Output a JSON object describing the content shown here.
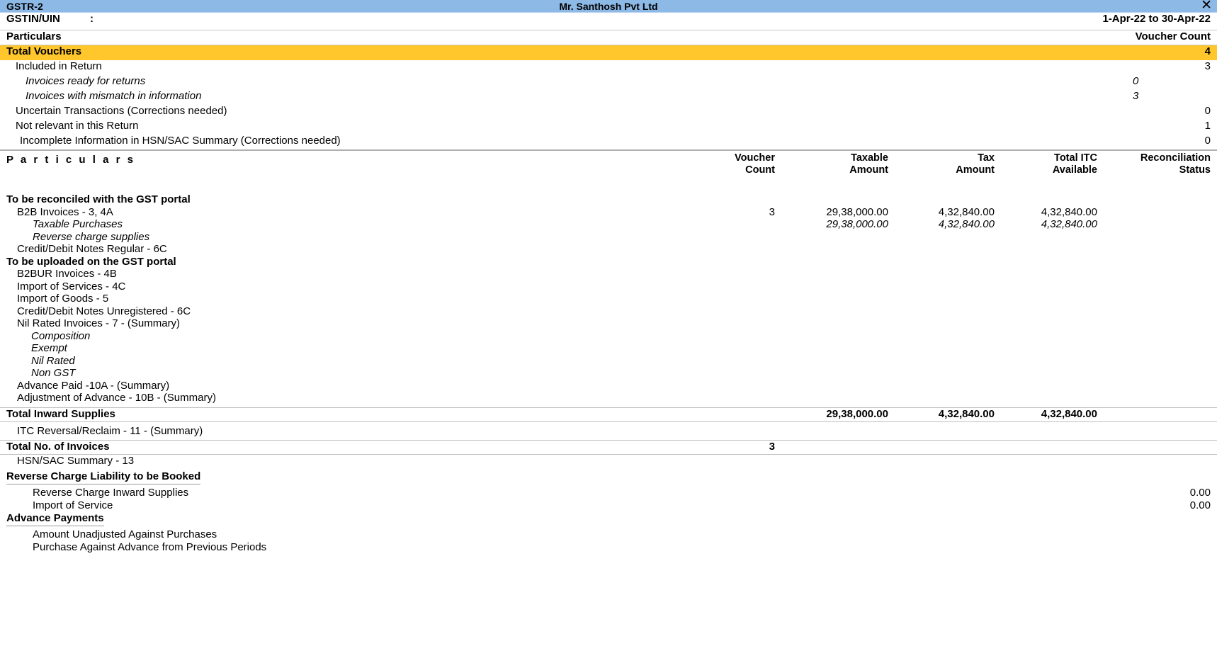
{
  "window": {
    "title": "GSTR-2",
    "company": "Mr. Santhosh Pvt Ltd",
    "close_icon": "close-icon",
    "close_glyph": "✕",
    "titlebar_color": "#8DB9E6"
  },
  "gstin": {
    "label": "GSTIN/UIN",
    "colon": ":",
    "value": "",
    "period": "1-Apr-22 to 30-Apr-22"
  },
  "summary_header": {
    "particulars": "Particulars",
    "voucher_count": "Voucher Count"
  },
  "summary": {
    "highlight_color": "#FFC72C",
    "total_vouchers": {
      "label": "Total Vouchers",
      "value": "4"
    },
    "rows": [
      {
        "label": "Included in Return",
        "mid": "",
        "value": "3",
        "indent": 1,
        "italic": false
      },
      {
        "label": "Invoices ready for returns",
        "mid": "0",
        "value": "",
        "indent": 2,
        "italic": true
      },
      {
        "label": "Invoices with mismatch in information",
        "mid": "3",
        "value": "",
        "indent": 2,
        "italic": true
      },
      {
        "label": "Uncertain Transactions (Corrections needed)",
        "mid": "",
        "value": "0",
        "indent": 1,
        "italic": false
      },
      {
        "label": "Not relevant in this Return",
        "mid": "",
        "value": "1",
        "indent": 1,
        "italic": false
      },
      {
        "label": "Incomplete Information in HSN/SAC Summary (Corrections needed)",
        "mid": "",
        "value": "0",
        "indent": 3,
        "italic": false
      }
    ]
  },
  "table_header": {
    "particulars": "P a r t i c u l a r s",
    "voucher_count_l1": "Voucher",
    "voucher_count_l2": "Count",
    "taxable_l1": "Taxable",
    "taxable_l2": "Amount",
    "tax_l1": "Tax",
    "tax_l2": "Amount",
    "itc_l1": "Total ITC",
    "itc_l2": "Available",
    "recon_l1": "Reconciliation",
    "recon_l2": "Status"
  },
  "table_rows": [
    {
      "label": "To be reconciled with the GST portal",
      "vc": "",
      "taxable": "",
      "tax": "",
      "itc": "",
      "recon": "",
      "indent": 0,
      "bold": true,
      "italic": false
    },
    {
      "label": "B2B Invoices - 3, 4A",
      "vc": "3",
      "taxable": "29,38,000.00",
      "tax": "4,32,840.00",
      "itc": "4,32,840.00",
      "recon": "",
      "indent": 1,
      "bold": false,
      "italic": false
    },
    {
      "label": "Taxable Purchases",
      "vc": "",
      "taxable": "29,38,000.00",
      "tax": "4,32,840.00",
      "itc": "4,32,840.00",
      "recon": "",
      "indent": 2,
      "bold": false,
      "italic": true
    },
    {
      "label": "Reverse charge supplies",
      "vc": "",
      "taxable": "",
      "tax": "",
      "itc": "",
      "recon": "",
      "indent": 2,
      "bold": false,
      "italic": true
    },
    {
      "label": "Credit/Debit Notes Regular - 6C",
      "vc": "",
      "taxable": "",
      "tax": "",
      "itc": "",
      "recon": "",
      "indent": 1,
      "bold": false,
      "italic": false
    },
    {
      "label": "To be uploaded on the GST portal",
      "vc": "",
      "taxable": "",
      "tax": "",
      "itc": "",
      "recon": "",
      "indent": 0,
      "bold": true,
      "italic": false
    },
    {
      "label": "B2BUR Invoices - 4B",
      "vc": "",
      "taxable": "",
      "tax": "",
      "itc": "",
      "recon": "",
      "indent": 1,
      "bold": false,
      "italic": false
    },
    {
      "label": "Import of Services - 4C",
      "vc": "",
      "taxable": "",
      "tax": "",
      "itc": "",
      "recon": "",
      "indent": 1,
      "bold": false,
      "italic": false
    },
    {
      "label": "Import of Goods - 5",
      "vc": "",
      "taxable": "",
      "tax": "",
      "itc": "",
      "recon": "",
      "indent": 1,
      "bold": false,
      "italic": false
    },
    {
      "label": "Credit/Debit Notes Unregistered - 6C",
      "vc": "",
      "taxable": "",
      "tax": "",
      "itc": "",
      "recon": "",
      "indent": 1,
      "bold": false,
      "italic": false
    },
    {
      "label": "Nil Rated Invoices - 7 - (Summary)",
      "vc": "",
      "taxable": "",
      "tax": "",
      "itc": "",
      "recon": "",
      "indent": 1,
      "bold": false,
      "italic": false
    },
    {
      "label": "Composition",
      "vc": "",
      "taxable": "",
      "tax": "",
      "itc": "",
      "recon": "",
      "indent": 2,
      "bold": false,
      "italic": true
    },
    {
      "label": "Exempt",
      "vc": "",
      "taxable": "",
      "tax": "",
      "itc": "",
      "recon": "",
      "indent": 2,
      "bold": false,
      "italic": true
    },
    {
      "label": "Nil Rated",
      "vc": "",
      "taxable": "",
      "tax": "",
      "itc": "",
      "recon": "",
      "indent": 2,
      "bold": false,
      "italic": true
    },
    {
      "label": "Non GST",
      "vc": "",
      "taxable": "",
      "tax": "",
      "itc": "",
      "recon": "",
      "indent": 2,
      "bold": false,
      "italic": true
    },
    {
      "label": "Advance Paid -10A - (Summary)",
      "vc": "",
      "taxable": "",
      "tax": "",
      "itc": "",
      "recon": "",
      "indent": 1,
      "bold": false,
      "italic": false
    },
    {
      "label": "Adjustment of Advance - 10B - (Summary)",
      "vc": "",
      "taxable": "",
      "tax": "",
      "itc": "",
      "recon": "",
      "indent": 1,
      "bold": false,
      "italic": false
    }
  ],
  "total_inward": {
    "label": "Total Inward Supplies",
    "vc": "",
    "taxable": "29,38,000.00",
    "tax": "4,32,840.00",
    "itc": "4,32,840.00",
    "recon": ""
  },
  "itc_reversal": {
    "label": "ITC Reversal/Reclaim - 11 - (Summary)"
  },
  "total_invoices": {
    "label": "Total No. of Invoices",
    "vc": "3"
  },
  "hsn_summary": {
    "label": "HSN/SAC Summary - 13"
  },
  "reverse_charge": {
    "heading": "Reverse Charge Liability to be Booked",
    "rows": [
      {
        "label": "Reverse Charge Inward Supplies",
        "value": "0.00"
      },
      {
        "label": "Import of Service",
        "value": "0.00"
      }
    ]
  },
  "advance_payments": {
    "heading": "Advance Payments",
    "rows": [
      {
        "label": "Amount Unadjusted Against Purchases",
        "value": ""
      },
      {
        "label": "Purchase Against Advance from Previous Periods",
        "value": ""
      }
    ]
  }
}
